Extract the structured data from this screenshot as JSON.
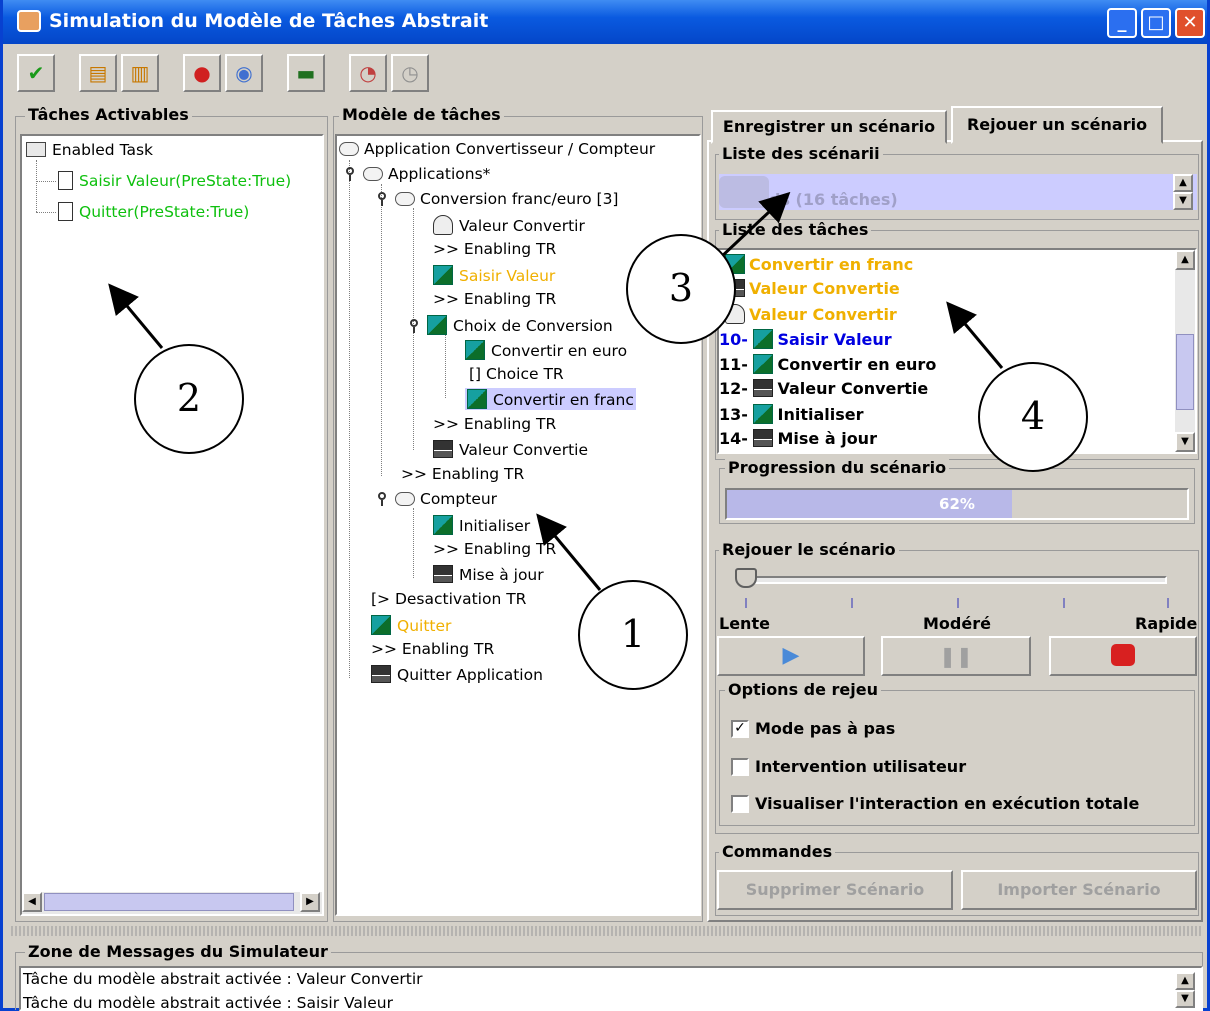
{
  "window": {
    "title": "Simulation du Modèle de Tâches Abstrait",
    "controls": [
      "_",
      "□",
      "✕"
    ]
  },
  "toolbar": {
    "icons": [
      "check-icon",
      "tree-expand-icon",
      "tree-swap-icon",
      "record-icon",
      "globe-icon",
      "keyboard-icon",
      "stopwatch-run-icon",
      "stopwatch-icon"
    ]
  },
  "left_panel": {
    "title": "Tâches Activables",
    "root": "Enabled Task",
    "items": [
      "Saisir Valeur(PreState:True)",
      "Quitter(PreState:True)"
    ]
  },
  "middle_panel": {
    "title": "Modèle de tâches",
    "nodes": [
      "Application Convertisseur / Compteur",
      "Applications*",
      "Conversion franc/euro [3]",
      "Valeur Convertir",
      ">> Enabling TR",
      "Saisir Valeur",
      ">> Enabling TR",
      "Choix de Conversion",
      "Convertir en euro",
      "[]  Choice TR",
      "Convertir en franc",
      ">> Enabling TR",
      "Valeur Convertie",
      ">> Enabling TR",
      "Compteur",
      "Initialiser",
      ">> Enabling TR",
      "Mise à jour",
      "[> Desactivation TR",
      "Quitter",
      ">> Enabling TR",
      "Quitter Application"
    ]
  },
  "right_panel": {
    "tabs": [
      "Enregistrer un scénario",
      "Rejouer un scénario"
    ],
    "scenarios_title": "Liste des scénarii",
    "scenario_value": "ds (16 tâches)",
    "tasks_title": "Liste des tâches",
    "tasks": [
      {
        "num": "",
        "label": "Convertir en franc"
      },
      {
        "num": "",
        "label": "Valeur Convertie"
      },
      {
        "num": "",
        "label": "Valeur Convertir"
      },
      {
        "num": "10-",
        "label": "Saisir Valeur"
      },
      {
        "num": "11-",
        "label": "Convertir en euro"
      },
      {
        "num": "12-",
        "label": "Valeur Convertie"
      },
      {
        "num": "13-",
        "label": "Initialiser"
      },
      {
        "num": "14-",
        "label": "Mise à jour"
      }
    ],
    "progress_title": "Progression du scénario",
    "progress": {
      "text": "62%",
      "value": 0.62
    },
    "replay_title": "Rejouer le scénario",
    "speed": {
      "labels": [
        "Lente",
        "Modéré",
        "Rapide"
      ],
      "value": 0
    },
    "options_title": "Options de rejeu",
    "options": [
      {
        "label": "Mode pas à pas",
        "checked": true
      },
      {
        "label": "Intervention utilisateur",
        "checked": false
      },
      {
        "label": "Visualiser l'interaction en exécution totale",
        "checked": false
      }
    ],
    "commands_title": "Commandes",
    "commands": [
      "Supprimer Scénario",
      "Importer Scénario"
    ]
  },
  "messages": {
    "title": "Zone de Messages du Simulateur",
    "lines": [
      "Tâche du modèle abstrait activée : Valeur Convertir",
      "Tâche du modèle abstrait activée : Saisir Valeur"
    ]
  },
  "annotations": [
    "1",
    "2",
    "3",
    "4"
  ],
  "colors": {
    "titlebar": "#0a5ae0",
    "enabled_task": "#0ec00e",
    "highlight": "#f0b000",
    "current": "#0000e0",
    "selection": "#ccccff",
    "progress": "#b8b8e8"
  }
}
